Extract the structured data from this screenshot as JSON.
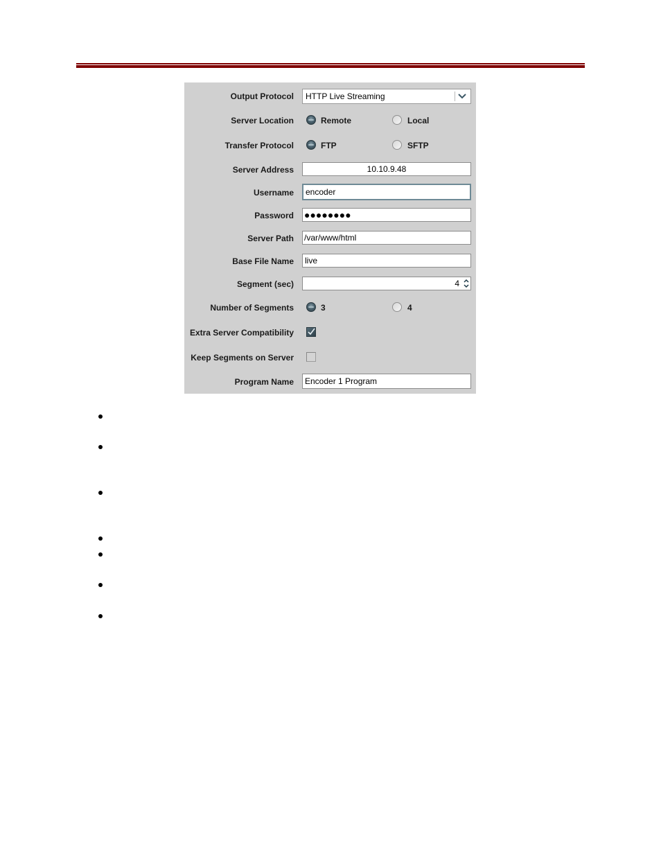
{
  "form": {
    "output_protocol": {
      "label": "Output Protocol",
      "value": "HTTP Live Streaming",
      "icon": "chevron-down-icon"
    },
    "server_location": {
      "label": "Server Location",
      "options": [
        {
          "label": "Remote",
          "selected": true
        },
        {
          "label": "Local",
          "selected": false
        }
      ]
    },
    "transfer_protocol": {
      "label": "Transfer Protocol",
      "options": [
        {
          "label": "FTP",
          "selected": true
        },
        {
          "label": "SFTP",
          "selected": false
        }
      ]
    },
    "server_address": {
      "label": "Server Address",
      "value": "10.10.9.48"
    },
    "username": {
      "label": "Username",
      "value": "encoder"
    },
    "password": {
      "label": "Password",
      "value": "●●●●●●●●"
    },
    "server_path": {
      "label": "Server Path",
      "value": "/var/www/html"
    },
    "base_file_name": {
      "label": "Base File Name",
      "value": "live"
    },
    "segment_sec": {
      "label": "Segment (sec)",
      "value": "4"
    },
    "number_of_segments": {
      "label": "Number of Segments",
      "options": [
        {
          "label": "3",
          "selected": true
        },
        {
          "label": "4",
          "selected": false
        }
      ]
    },
    "extra_server_compatibility": {
      "label": "Extra Server Compatibility",
      "checked": true
    },
    "keep_segments_on_server": {
      "label": "Keep Segments on Server",
      "checked": false
    },
    "program_name": {
      "label": "Program Name",
      "value": "Encoder 1 Program"
    }
  },
  "colors": {
    "header_rule": "#7f0000",
    "panel_bg": "#d0d0d0"
  },
  "bullets_count": 7
}
